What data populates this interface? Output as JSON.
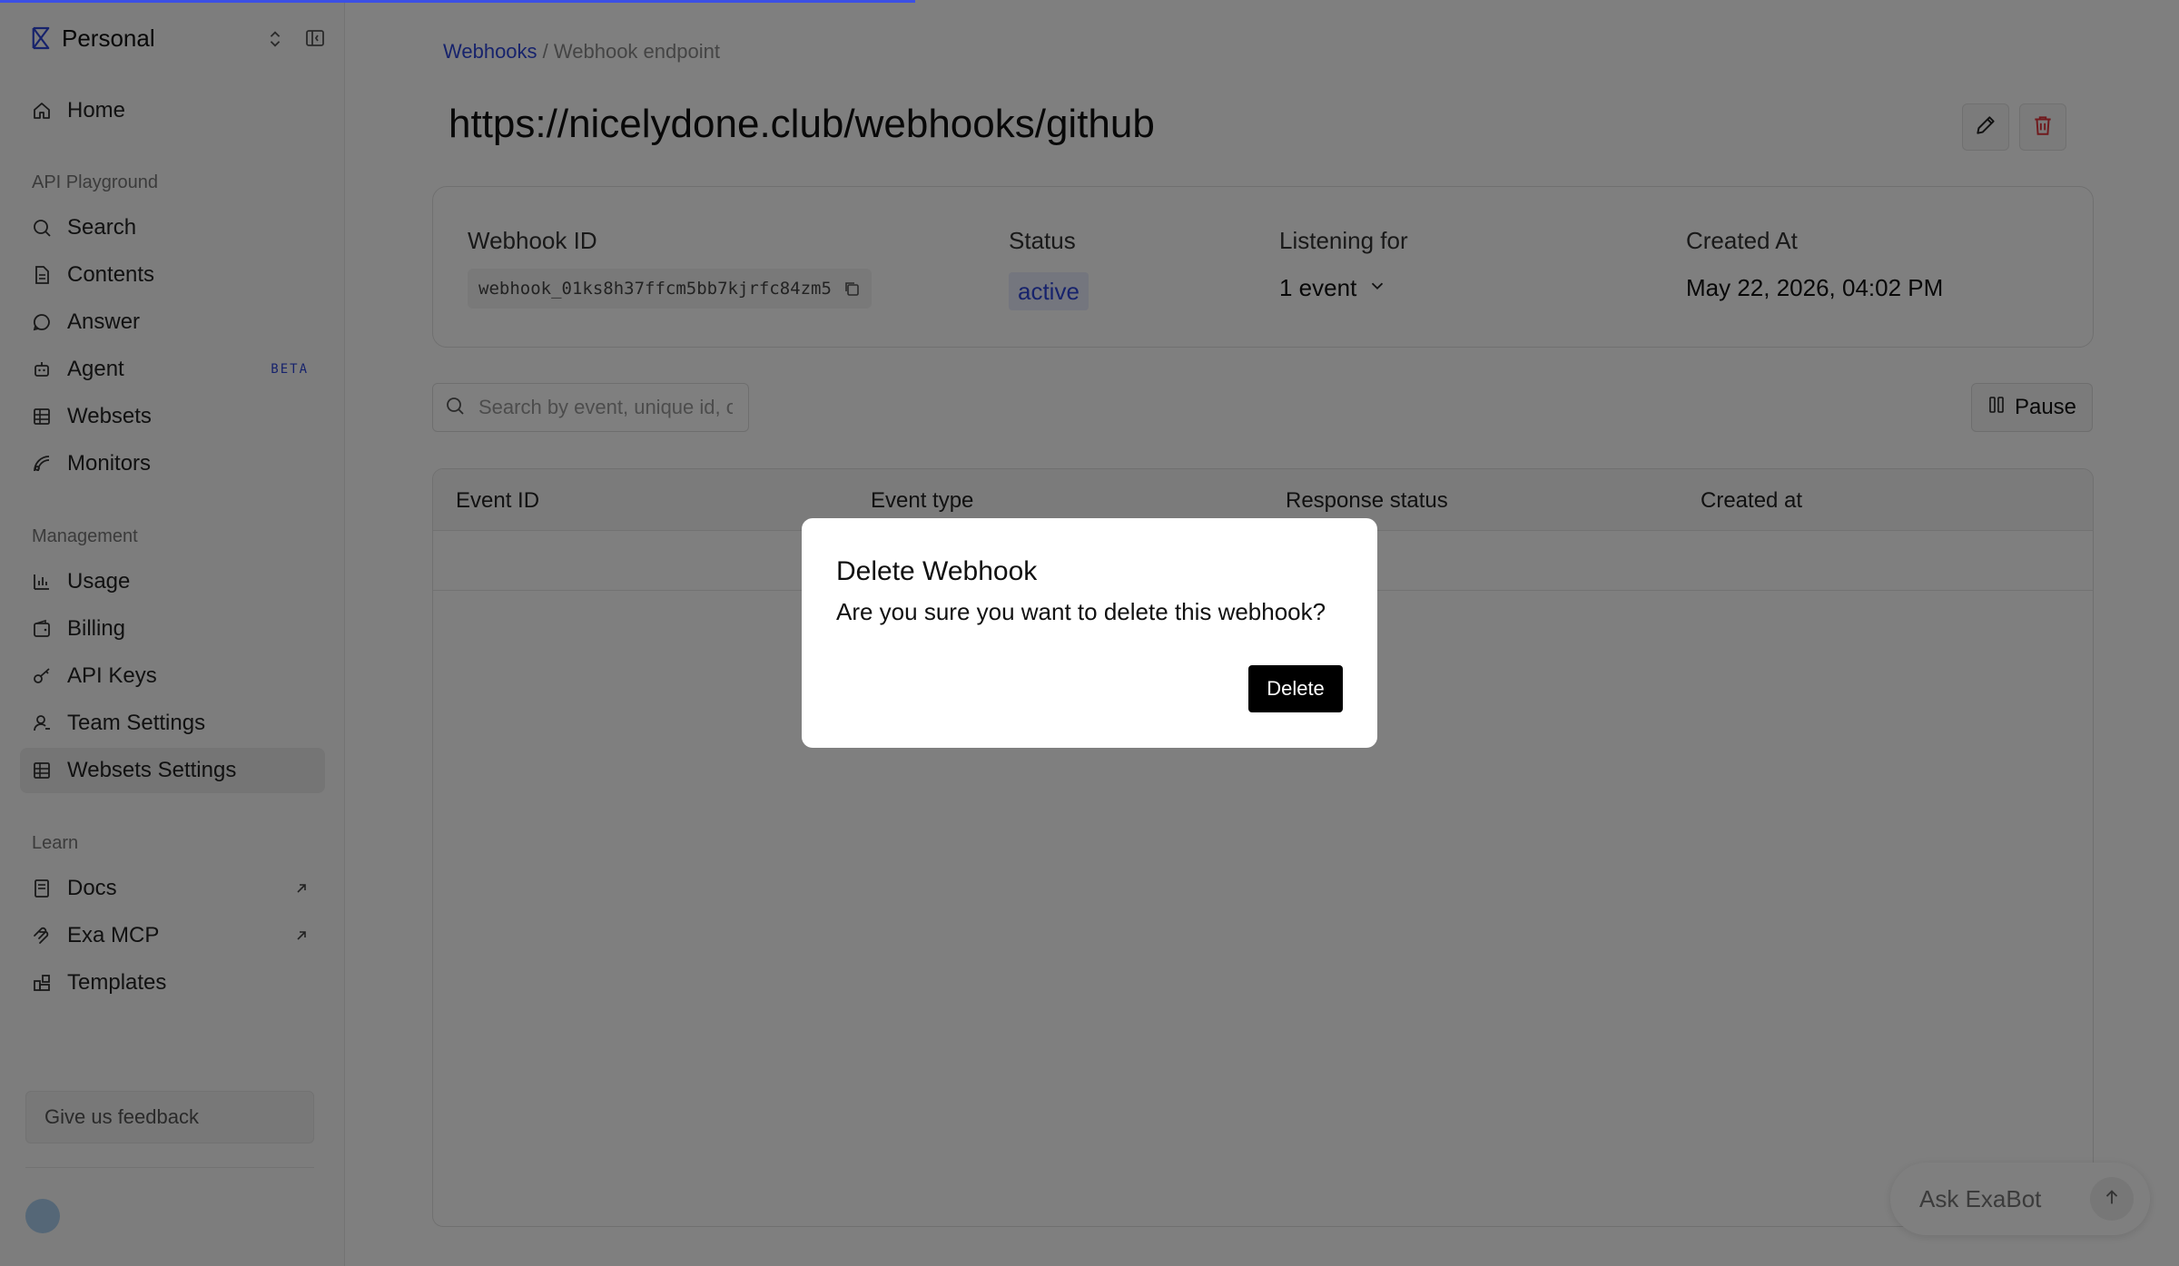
{
  "workspace": {
    "name": "Personal"
  },
  "nav": {
    "home": "Home",
    "api_playground_label": "API Playground",
    "search": "Search",
    "contents": "Contents",
    "answer": "Answer",
    "agent": "Agent",
    "agent_badge": "BETA",
    "websets": "Websets",
    "monitors": "Monitors",
    "management_label": "Management",
    "usage": "Usage",
    "billing": "Billing",
    "api_keys": "API Keys",
    "team_settings": "Team Settings",
    "websets_settings": "Websets Settings",
    "learn_label": "Learn",
    "docs": "Docs",
    "exa_mcp": "Exa MCP",
    "templates": "Templates",
    "feedback": "Give us feedback"
  },
  "breadcrumb": {
    "parent": "Webhooks",
    "separator": " / ",
    "current": "Webhook endpoint"
  },
  "page": {
    "title": "https://nicelydone.club/webhooks/github"
  },
  "webhook": {
    "id_label": "Webhook ID",
    "id_value": "webhook_01ks8h37ffcm5bb7kjrfc84zm5",
    "status_label": "Status",
    "status_value": "active",
    "listening_label": "Listening for",
    "listening_value": "1 event",
    "created_label": "Created At",
    "created_value": "May 22, 2026, 04:02 PM"
  },
  "events_search": {
    "placeholder": "Search by event, unique id, o"
  },
  "pause_label": "Pause",
  "table": {
    "columns": [
      "Event ID",
      "Event type",
      "Response status",
      "Created at"
    ]
  },
  "exabot": {
    "placeholder": "Ask ExaBot"
  },
  "modal": {
    "title": "Delete Webhook",
    "message": "Are you sure you want to delete this webhook?",
    "confirm_label": "Delete"
  },
  "colors": {
    "accent": "#2f47d8",
    "danger": "#e0353a",
    "overlay": "rgba(0,0,0,0.5)"
  },
  "loading_progress": 0.42
}
